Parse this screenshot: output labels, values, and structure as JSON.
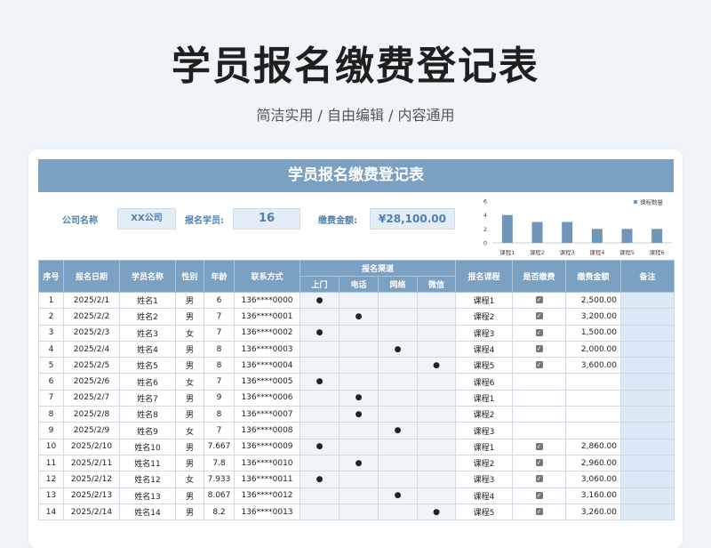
{
  "header": {
    "title": "学员报名缴费登记表",
    "subtitle": "简洁实用 / 自由编辑 / 内容通用"
  },
  "sheet": {
    "banner_title": "学员报名缴费登记表",
    "info": {
      "company_label": "公司名称",
      "company_value": "XX公司",
      "students_label": "报名学员:",
      "students_value": "16",
      "amount_label": "缴费金额:",
      "amount_value": "¥28,100.00"
    },
    "columns": {
      "no": "序号",
      "date": "报名日期",
      "name": "学员名称",
      "gender": "性别",
      "age": "年龄",
      "contact": "联系方式",
      "channel_group": "报名渠道",
      "channels": [
        "上门",
        "电话",
        "网络",
        "微信"
      ],
      "course": "报名课程",
      "paid": "是否缴费",
      "amount": "缴费金额",
      "note": "备注"
    },
    "channel_mark": "●",
    "paid_mark": "✓",
    "rows": [
      {
        "no": "1",
        "date": "2025/2/1",
        "name": "姓名1",
        "gender": "男",
        "age": "6",
        "contact": "136****0000",
        "channel": 0,
        "course": "课程1",
        "paid": true,
        "amount": "2,500.00"
      },
      {
        "no": "2",
        "date": "2025/2/2",
        "name": "姓名2",
        "gender": "男",
        "age": "7",
        "contact": "136****0001",
        "channel": 1,
        "course": "课程2",
        "paid": true,
        "amount": "3,200.00"
      },
      {
        "no": "3",
        "date": "2025/2/3",
        "name": "姓名3",
        "gender": "女",
        "age": "7",
        "contact": "136****0002",
        "channel": 0,
        "course": "课程3",
        "paid": true,
        "amount": "1,500.00"
      },
      {
        "no": "4",
        "date": "2025/2/4",
        "name": "姓名4",
        "gender": "男",
        "age": "8",
        "contact": "136****0003",
        "channel": 2,
        "course": "课程4",
        "paid": true,
        "amount": "2,000.00"
      },
      {
        "no": "5",
        "date": "2025/2/5",
        "name": "姓名5",
        "gender": "男",
        "age": "8",
        "contact": "136****0004",
        "channel": 3,
        "course": "课程5",
        "paid": true,
        "amount": "3,600.00"
      },
      {
        "no": "6",
        "date": "2025/2/6",
        "name": "姓名6",
        "gender": "女",
        "age": "7",
        "contact": "136****0005",
        "channel": 0,
        "course": "课程6",
        "paid": false,
        "amount": ""
      },
      {
        "no": "7",
        "date": "2025/2/7",
        "name": "姓名7",
        "gender": "男",
        "age": "9",
        "contact": "136****0006",
        "channel": 1,
        "course": "课程1",
        "paid": false,
        "amount": ""
      },
      {
        "no": "8",
        "date": "2025/2/8",
        "name": "姓名8",
        "gender": "男",
        "age": "8",
        "contact": "136****0007",
        "channel": 1,
        "course": "课程2",
        "paid": false,
        "amount": ""
      },
      {
        "no": "9",
        "date": "2025/2/9",
        "name": "姓名9",
        "gender": "女",
        "age": "7",
        "contact": "136****0008",
        "channel": 2,
        "course": "课程3",
        "paid": false,
        "amount": ""
      },
      {
        "no": "10",
        "date": "2025/2/10",
        "name": "姓名10",
        "gender": "男",
        "age": "7.667",
        "contact": "136****0009",
        "channel": 0,
        "course": "课程1",
        "paid": true,
        "amount": "2,860.00"
      },
      {
        "no": "11",
        "date": "2025/2/11",
        "name": "姓名11",
        "gender": "男",
        "age": "7.8",
        "contact": "136****0010",
        "channel": 1,
        "course": "课程2",
        "paid": true,
        "amount": "2,960.00"
      },
      {
        "no": "12",
        "date": "2025/2/12",
        "name": "姓名12",
        "gender": "女",
        "age": "7.933",
        "contact": "136****0011",
        "channel": 0,
        "course": "课程3",
        "paid": true,
        "amount": "3,060.00"
      },
      {
        "no": "13",
        "date": "2025/2/13",
        "name": "姓名13",
        "gender": "男",
        "age": "8.067",
        "contact": "136****0012",
        "channel": 2,
        "course": "课程4",
        "paid": true,
        "amount": "3,160.00"
      },
      {
        "no": "14",
        "date": "2025/2/14",
        "name": "姓名14",
        "gender": "男",
        "age": "8.2",
        "contact": "136****0013",
        "channel": 3,
        "course": "课程5",
        "paid": true,
        "amount": "3,260.00"
      }
    ]
  },
  "colors": {
    "accent": "#7aa0c2",
    "bar": "#6f95bb",
    "label_blue": "#4e7fae",
    "page_bg": "#eef4f7"
  },
  "chart_data": {
    "type": "bar",
    "categories": [
      "课程1",
      "课程2",
      "课程3",
      "课程4",
      "课程5",
      "课程6"
    ],
    "series": [
      {
        "name": "课程数量",
        "values": [
          4,
          3,
          3,
          2,
          2,
          2
        ]
      }
    ],
    "ylim": [
      0,
      6
    ],
    "yticks": [
      0,
      2,
      4,
      6
    ],
    "legend": "top-right",
    "grid": false
  }
}
